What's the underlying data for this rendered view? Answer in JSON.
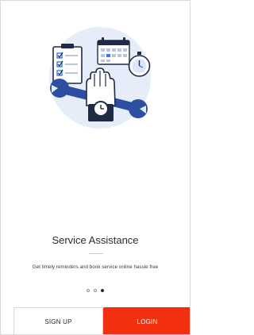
{
  "onboarding": {
    "title": "Service Assistance",
    "subtitle": "Get timely reminders and book service online hassle free",
    "illustration_icons": [
      "checklist-icon",
      "calendar-icon",
      "stopwatch-icon",
      "wrench-icon",
      "hand-with-watch-icon"
    ],
    "pager": {
      "count": 3,
      "active_index": 2
    }
  },
  "actions": {
    "signup_label": "SIGN UP",
    "login_label": "LOGIN"
  },
  "colors": {
    "accent": "#f2300f",
    "illustration_bg": "#e6edf8",
    "dark": "#1f2b44",
    "blue": "#3b7be8"
  }
}
